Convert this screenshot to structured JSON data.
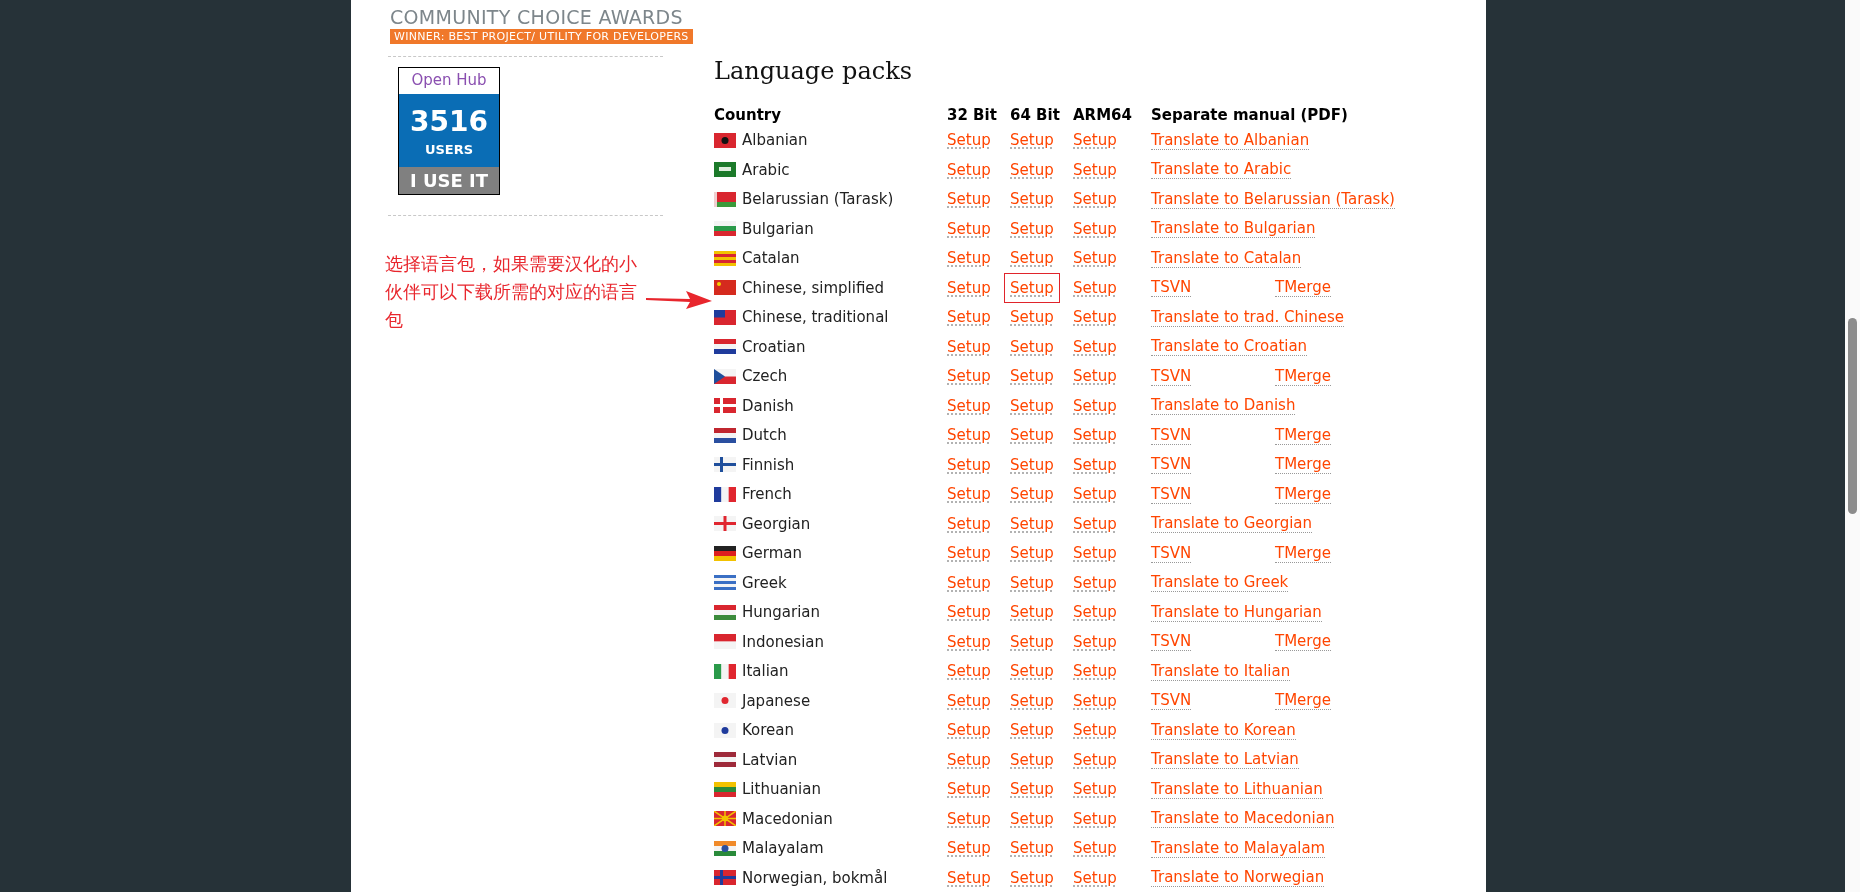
{
  "sidebar": {
    "award": {
      "title": "COMMUNITY CHOICE AWARDS",
      "ribbon": "WINNER: BEST PROJECT/ UTILITY FOR DEVELOPERS"
    },
    "openhub_badge": {
      "brand": "Open Hub",
      "count": "3516",
      "unit": "USERS",
      "action": "I USE IT"
    }
  },
  "annotation": {
    "text": "选择语言包，如果需要汉化的小伙伴可以下载所需的对应的语言包"
  },
  "language_packs": {
    "title": "Language packs",
    "columns": [
      "Country",
      "32 Bit",
      "64 Bit",
      "ARM64",
      "Separate manual (PDF)"
    ],
    "rows": [
      {
        "country": "Albanian",
        "setups": [
          {
            "label": "Setup",
            "highlighted": false
          },
          {
            "label": "Setup",
            "highlighted": false
          },
          {
            "label": "Setup",
            "highlighted": false
          }
        ],
        "manual": [
          "Translate to Albanian"
        ]
      },
      {
        "country": "Arabic",
        "setups": [
          {
            "label": "Setup",
            "highlighted": false
          },
          {
            "label": "Setup",
            "highlighted": false
          },
          {
            "label": "Setup",
            "highlighted": false
          }
        ],
        "manual": [
          "Translate to Arabic"
        ]
      },
      {
        "country": "Belarussian (Tarask)",
        "setups": [
          {
            "label": "Setup",
            "highlighted": false
          },
          {
            "label": "Setup",
            "highlighted": false
          },
          {
            "label": "Setup",
            "highlighted": false
          }
        ],
        "manual": [
          "Translate to Belarussian (Tarask)"
        ]
      },
      {
        "country": "Bulgarian",
        "setups": [
          {
            "label": "Setup",
            "highlighted": false
          },
          {
            "label": "Setup",
            "highlighted": false
          },
          {
            "label": "Setup",
            "highlighted": false
          }
        ],
        "manual": [
          "Translate to Bulgarian"
        ]
      },
      {
        "country": "Catalan",
        "setups": [
          {
            "label": "Setup",
            "highlighted": false
          },
          {
            "label": "Setup",
            "highlighted": false
          },
          {
            "label": "Setup",
            "highlighted": false
          }
        ],
        "manual": [
          "Translate to Catalan"
        ]
      },
      {
        "country": "Chinese, simplified",
        "setups": [
          {
            "label": "Setup",
            "highlighted": false
          },
          {
            "label": "Setup",
            "highlighted": true
          },
          {
            "label": "Setup",
            "highlighted": false
          }
        ],
        "manual": [
          "TSVN",
          "TMerge"
        ]
      },
      {
        "country": "Chinese, traditional",
        "setups": [
          {
            "label": "Setup",
            "highlighted": false
          },
          {
            "label": "Setup",
            "highlighted": false
          },
          {
            "label": "Setup",
            "highlighted": false
          }
        ],
        "manual": [
          "Translate to trad. Chinese"
        ]
      },
      {
        "country": "Croatian",
        "setups": [
          {
            "label": "Setup",
            "highlighted": false
          },
          {
            "label": "Setup",
            "highlighted": false
          },
          {
            "label": "Setup",
            "highlighted": false
          }
        ],
        "manual": [
          "Translate to Croatian"
        ]
      },
      {
        "country": "Czech",
        "setups": [
          {
            "label": "Setup",
            "highlighted": false
          },
          {
            "label": "Setup",
            "highlighted": false
          },
          {
            "label": "Setup",
            "highlighted": false
          }
        ],
        "manual": [
          "TSVN",
          "TMerge"
        ]
      },
      {
        "country": "Danish",
        "setups": [
          {
            "label": "Setup",
            "highlighted": false
          },
          {
            "label": "Setup",
            "highlighted": false
          },
          {
            "label": "Setup",
            "highlighted": false
          }
        ],
        "manual": [
          "Translate to Danish"
        ]
      },
      {
        "country": "Dutch",
        "setups": [
          {
            "label": "Setup",
            "highlighted": false
          },
          {
            "label": "Setup",
            "highlighted": false
          },
          {
            "label": "Setup",
            "highlighted": false
          }
        ],
        "manual": [
          "TSVN",
          "TMerge"
        ]
      },
      {
        "country": "Finnish",
        "setups": [
          {
            "label": "Setup",
            "highlighted": false
          },
          {
            "label": "Setup",
            "highlighted": false
          },
          {
            "label": "Setup",
            "highlighted": false
          }
        ],
        "manual": [
          "TSVN",
          "TMerge"
        ]
      },
      {
        "country": "French",
        "setups": [
          {
            "label": "Setup",
            "highlighted": false
          },
          {
            "label": "Setup",
            "highlighted": false
          },
          {
            "label": "Setup",
            "highlighted": false
          }
        ],
        "manual": [
          "TSVN",
          "TMerge"
        ]
      },
      {
        "country": "Georgian",
        "setups": [
          {
            "label": "Setup",
            "highlighted": false
          },
          {
            "label": "Setup",
            "highlighted": false
          },
          {
            "label": "Setup",
            "highlighted": false
          }
        ],
        "manual": [
          "Translate to Georgian"
        ]
      },
      {
        "country": "German",
        "setups": [
          {
            "label": "Setup",
            "highlighted": false
          },
          {
            "label": "Setup",
            "highlighted": false
          },
          {
            "label": "Setup",
            "highlighted": false
          }
        ],
        "manual": [
          "TSVN",
          "TMerge"
        ]
      },
      {
        "country": "Greek",
        "setups": [
          {
            "label": "Setup",
            "highlighted": false
          },
          {
            "label": "Setup",
            "highlighted": false
          },
          {
            "label": "Setup",
            "highlighted": false
          }
        ],
        "manual": [
          "Translate to Greek"
        ]
      },
      {
        "country": "Hungarian",
        "setups": [
          {
            "label": "Setup",
            "highlighted": false
          },
          {
            "label": "Setup",
            "highlighted": false
          },
          {
            "label": "Setup",
            "highlighted": false
          }
        ],
        "manual": [
          "Translate to Hungarian"
        ]
      },
      {
        "country": "Indonesian",
        "setups": [
          {
            "label": "Setup",
            "highlighted": false
          },
          {
            "label": "Setup",
            "highlighted": false
          },
          {
            "label": "Setup",
            "highlighted": false
          }
        ],
        "manual": [
          "TSVN",
          "TMerge"
        ]
      },
      {
        "country": "Italian",
        "setups": [
          {
            "label": "Setup",
            "highlighted": false
          },
          {
            "label": "Setup",
            "highlighted": false
          },
          {
            "label": "Setup",
            "highlighted": false
          }
        ],
        "manual": [
          "Translate to Italian"
        ]
      },
      {
        "country": "Japanese",
        "setups": [
          {
            "label": "Setup",
            "highlighted": false
          },
          {
            "label": "Setup",
            "highlighted": false
          },
          {
            "label": "Setup",
            "highlighted": false
          }
        ],
        "manual": [
          "TSVN",
          "TMerge"
        ]
      },
      {
        "country": "Korean",
        "setups": [
          {
            "label": "Setup",
            "highlighted": false
          },
          {
            "label": "Setup",
            "highlighted": false
          },
          {
            "label": "Setup",
            "highlighted": false
          }
        ],
        "manual": [
          "Translate to Korean"
        ]
      },
      {
        "country": "Latvian",
        "setups": [
          {
            "label": "Setup",
            "highlighted": false
          },
          {
            "label": "Setup",
            "highlighted": false
          },
          {
            "label": "Setup",
            "highlighted": false
          }
        ],
        "manual": [
          "Translate to Latvian"
        ]
      },
      {
        "country": "Lithuanian",
        "setups": [
          {
            "label": "Setup",
            "highlighted": false
          },
          {
            "label": "Setup",
            "highlighted": false
          },
          {
            "label": "Setup",
            "highlighted": false
          }
        ],
        "manual": [
          "Translate to Lithuanian"
        ]
      },
      {
        "country": "Macedonian",
        "setups": [
          {
            "label": "Setup",
            "highlighted": false
          },
          {
            "label": "Setup",
            "highlighted": false
          },
          {
            "label": "Setup",
            "highlighted": false
          }
        ],
        "manual": [
          "Translate to Macedonian"
        ]
      },
      {
        "country": "Malayalam",
        "setups": [
          {
            "label": "Setup",
            "highlighted": false
          },
          {
            "label": "Setup",
            "highlighted": false
          },
          {
            "label": "Setup",
            "highlighted": false
          }
        ],
        "manual": [
          "Translate to Malayalam"
        ]
      },
      {
        "country": "Norwegian, bokmål",
        "setups": [
          {
            "label": "Setup",
            "highlighted": false
          },
          {
            "label": "Setup",
            "highlighted": false
          },
          {
            "label": "Setup",
            "highlighted": false
          }
        ],
        "manual": [
          "Translate to Norwegian"
        ]
      }
    ]
  }
}
